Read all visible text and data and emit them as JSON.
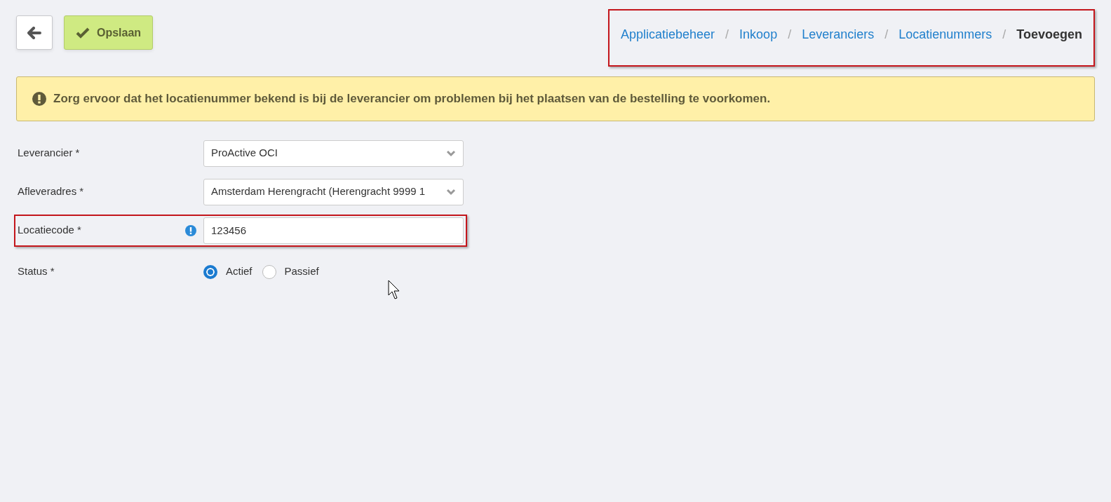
{
  "toolbar": {
    "save_label": "Opslaan"
  },
  "breadcrumb": {
    "highlighted": true,
    "items": [
      {
        "label": "Applicatiebeheer",
        "selected": false
      },
      {
        "label": "Inkoop",
        "selected": false
      },
      {
        "label": "Leveranciers",
        "selected": false
      },
      {
        "label": "Locatienummers",
        "selected": false
      },
      {
        "label": "Toevoegen",
        "selected": true
      }
    ],
    "separators": [
      "/",
      "/",
      "/",
      "/"
    ]
  },
  "alert": {
    "text": "Zorg ervoor dat het locatienummer bekend is bij de leverancier om problemen bij het plaatsen van de bestelling te voorkomen."
  },
  "form": {
    "fields": [
      {
        "kind": "select",
        "label": "Leverancier *",
        "value": "ProActive OCI",
        "info": false,
        "highlighted": false
      },
      {
        "kind": "select",
        "label": "Afleveradres *",
        "value": "Amsterdam Herengracht (Herengracht 9999 1",
        "info": false,
        "highlighted": false
      },
      {
        "kind": "text",
        "label": "Locatiecode *",
        "value": "123456",
        "info": true,
        "highlighted": true
      },
      {
        "kind": "radio",
        "label": "Status *",
        "options": [
          {
            "label": "Actief",
            "selected": true
          },
          {
            "label": "Passief",
            "selected": false
          }
        ]
      }
    ]
  }
}
